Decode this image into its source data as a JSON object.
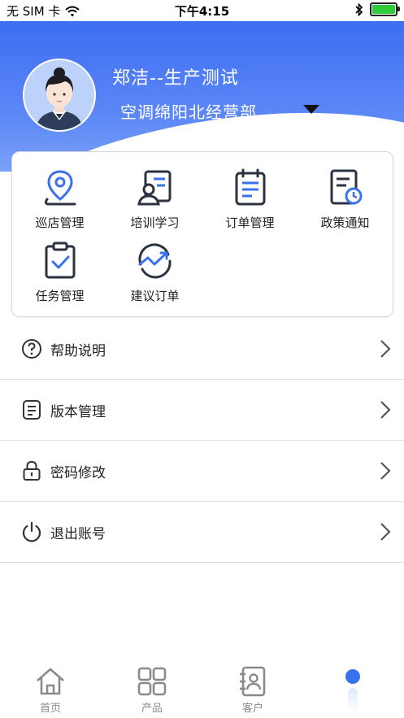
{
  "status_bar": {
    "carrier": "无 SIM 卡",
    "time": "下午4:15",
    "battery_color": "#2fcb3c"
  },
  "header": {
    "user_name": "郑洁--生产测试",
    "department": "空调绵阳北经营部",
    "gradient_color": "#3e6ef2"
  },
  "features": [
    {
      "label": "巡店管理",
      "icon": "location-pin-icon"
    },
    {
      "label": "培训学习",
      "icon": "training-board-icon"
    },
    {
      "label": "订单管理",
      "icon": "clipboard-list-icon"
    },
    {
      "label": "政策通知",
      "icon": "document-clock-icon"
    },
    {
      "label": "任务管理",
      "icon": "task-checklist-icon"
    },
    {
      "label": "建议订单",
      "icon": "trend-up-icon"
    }
  ],
  "menu": [
    {
      "label": "帮助说明",
      "icon": "help-circle-icon"
    },
    {
      "label": "版本管理",
      "icon": "version-doc-icon"
    },
    {
      "label": "密码修改",
      "icon": "lock-icon"
    },
    {
      "label": "退出账号",
      "icon": "power-icon"
    }
  ],
  "tabs": [
    {
      "label": "首页",
      "icon": "home-icon"
    },
    {
      "label": "产品",
      "icon": "grid-icon"
    },
    {
      "label": "客户",
      "icon": "contact-card-icon"
    }
  ],
  "accent_color": "#3a72ee",
  "icon_dark_color": "#2b3340"
}
